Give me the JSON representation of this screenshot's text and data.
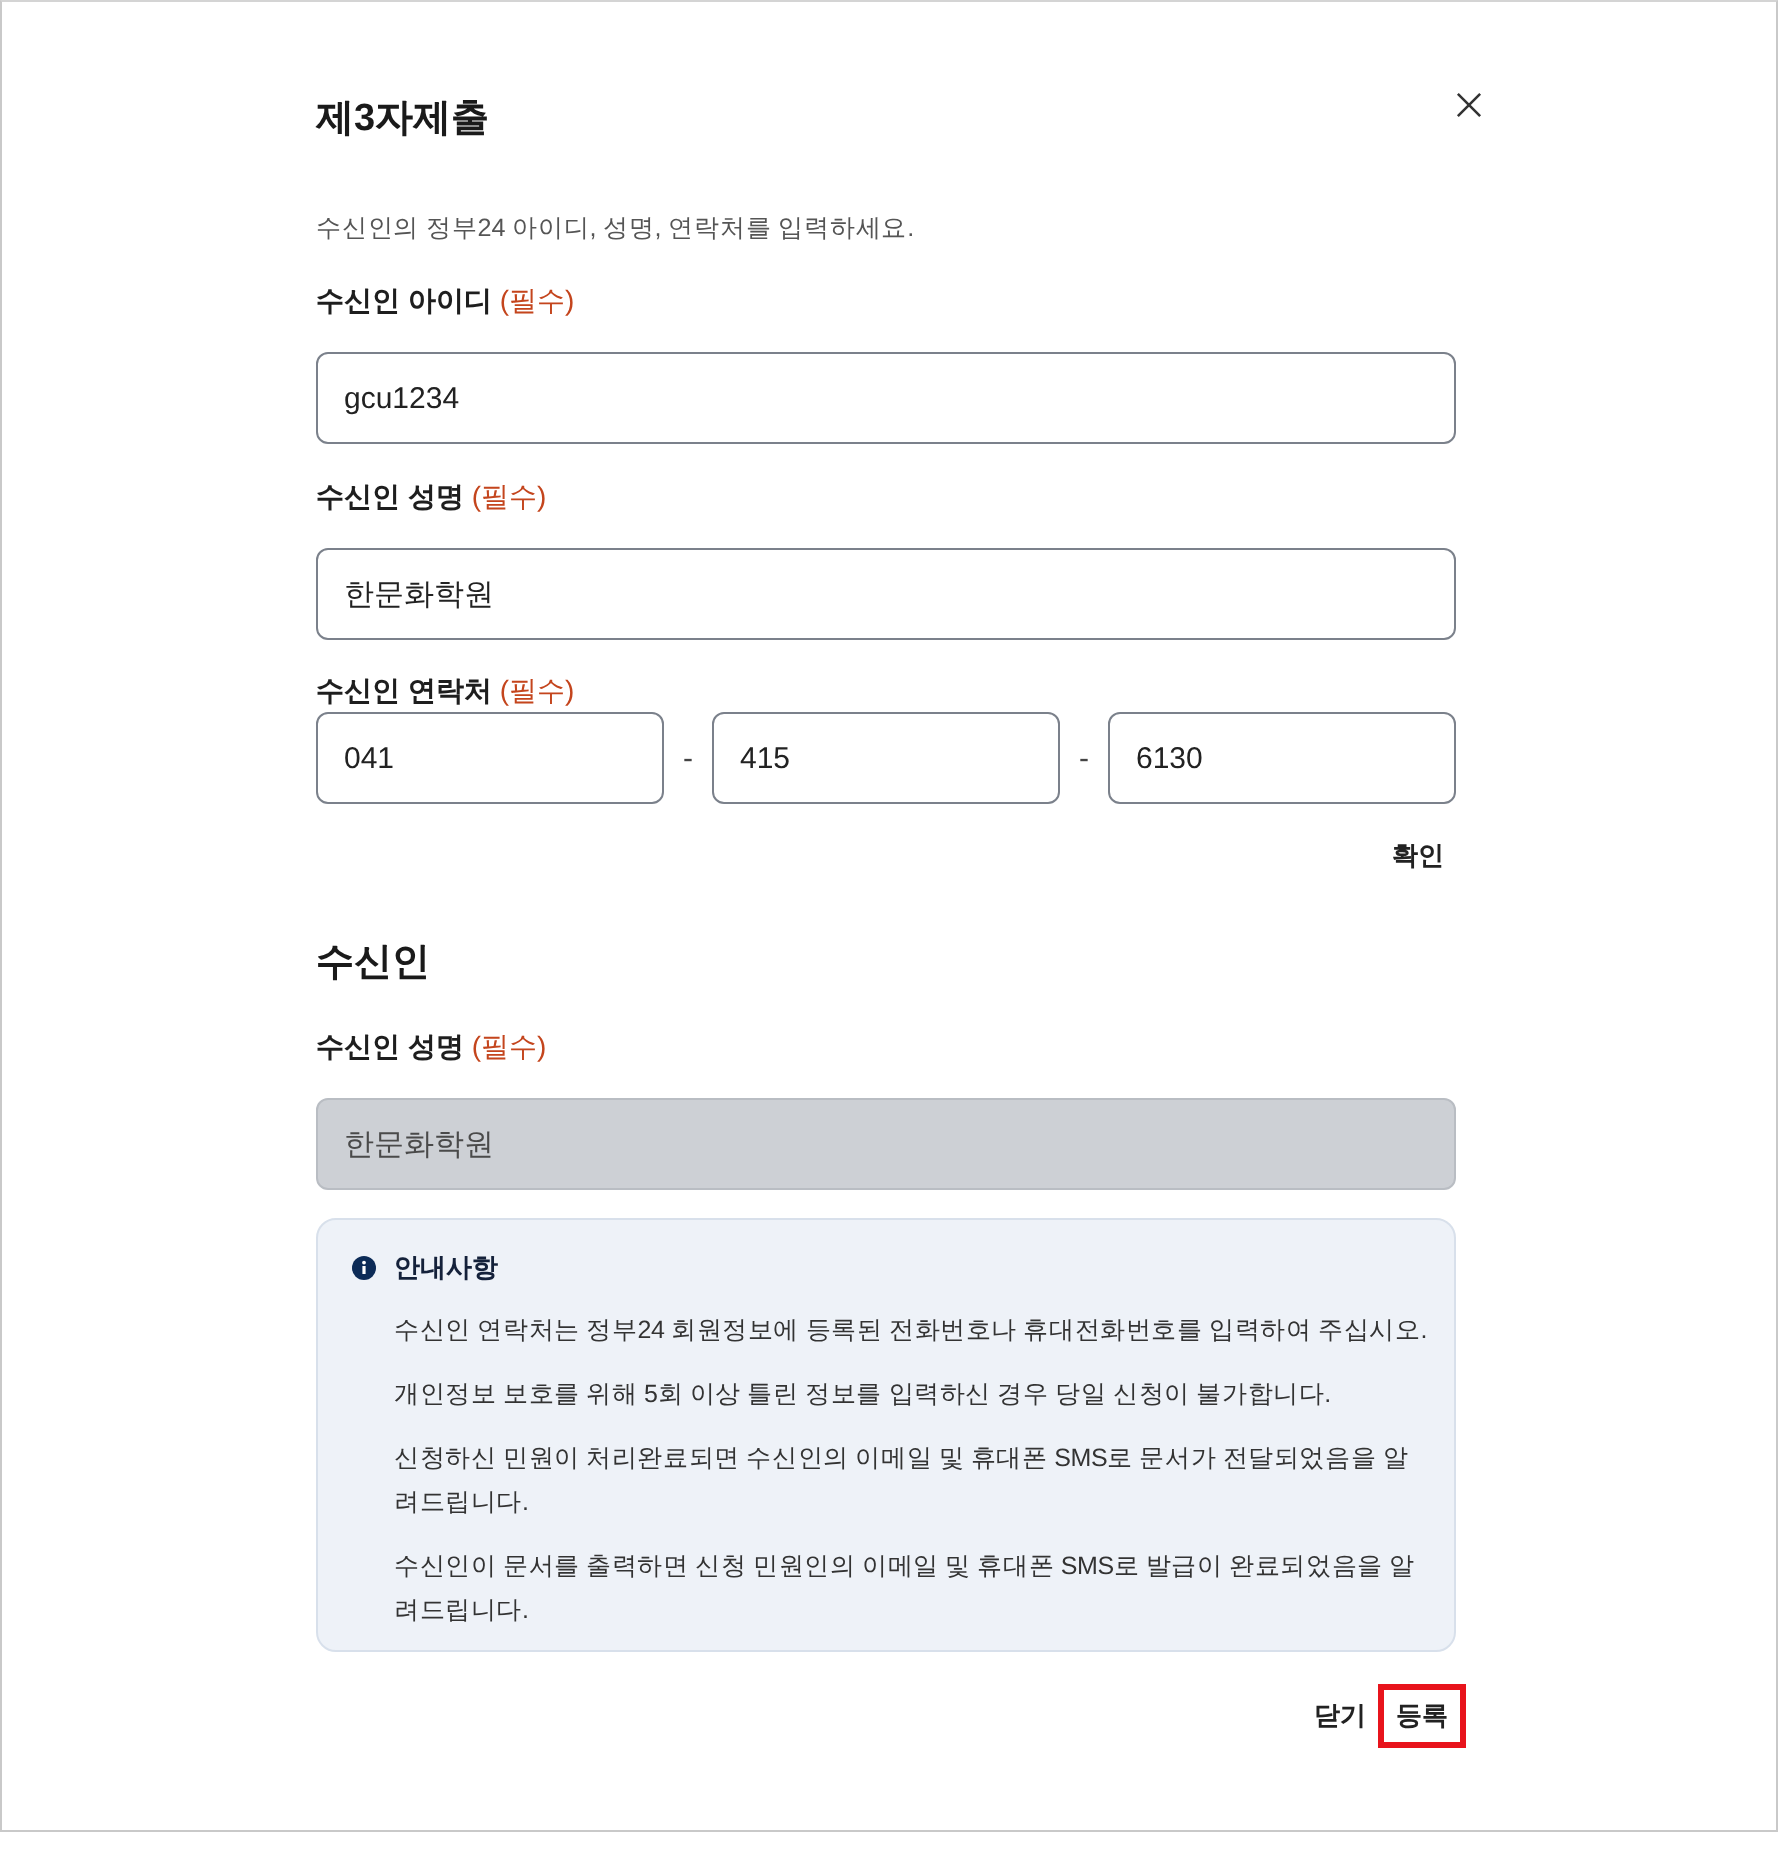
{
  "dialog": {
    "title": "제3자제출",
    "description": "수신인의 정부24 아이디, 성명, 연락처를 입력하세요."
  },
  "form": {
    "fields": [
      {
        "kind": "text",
        "label": "수신인 아이디",
        "required": "(필수)",
        "value": "gcu1234",
        "disabled": false
      },
      {
        "kind": "text",
        "label": "수신인 성명",
        "required": "(필수)",
        "value": "한문화학원",
        "disabled": false
      },
      {
        "kind": "phone",
        "label": "수신인 연락처",
        "required": "(필수)",
        "values": [
          "041",
          "415",
          "6130"
        ],
        "separators": [
          "-",
          "-"
        ]
      }
    ],
    "confirm_button": "확인"
  },
  "recipient": {
    "heading": "수신인",
    "fields": [
      {
        "kind": "text",
        "label": "수신인 성명",
        "required": "(필수)",
        "value": "한문화학원",
        "disabled": true
      }
    ]
  },
  "notice": {
    "title": "안내사항",
    "items": [
      "수신인 연락처는 정부24 회원정보에 등록된 전화번호나 휴대전화번호를 입력하여 주십시오.",
      "개인정보 보호를 위해 5회 이상 틀린 정보를 입력하신 경우 당일 신청이 불가합니다.",
      "신청하신 민원이 처리완료되면 수신인의 이메일 및 휴대폰 SMS로 문서가 전달되었음을 알려드립니다.",
      "수신인이 문서를 출력하면 신청 민원인의 이메일 및 휴대폰 SMS로 발급이 완료되었음을 알려드립니다."
    ]
  },
  "buttons": [
    {
      "label": "닫기",
      "highlighted": false
    },
    {
      "label": "등록",
      "highlighted": true
    }
  ]
}
